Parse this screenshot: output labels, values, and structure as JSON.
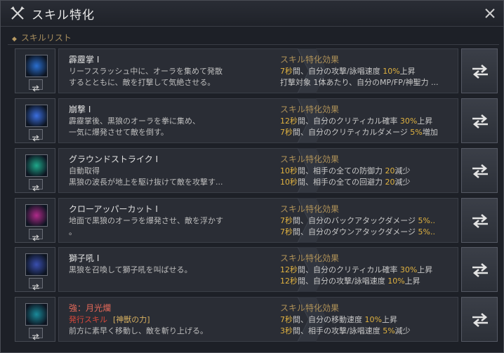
{
  "window": {
    "title": "スキル特化",
    "title_icon": "crossed-axes-icon",
    "close_icon": "close-icon"
  },
  "section": {
    "label": "スキルリスト"
  },
  "effects_header": "スキル特化効果",
  "skills": [
    {
      "name": "霹靂掌 I",
      "icon_color": "#2a6fd0",
      "desc": [
        "リーフスラッシュ中に、オーラを集めて発散",
        "するとともに、敵を打撃して気絶させる。"
      ],
      "effects": [
        [
          {
            "t": "7秒",
            "hl": true
          },
          {
            "t": "間、自分の攻撃/詠唱速度 "
          },
          {
            "t": "10%",
            "hl": true
          },
          {
            "t": "上昇"
          }
        ],
        [
          {
            "t": "打撃対象 1体あたり、自分のMP/FP/神聖力 ..."
          }
        ]
      ]
    },
    {
      "name": "崩撃 I",
      "icon_color": "#3b6fe0",
      "desc": [
        "霹靂掌後、黒狼のオーラを拳に集め、",
        "一気に爆発させて敵を倒す。"
      ],
      "effects": [
        [
          {
            "t": "12秒",
            "hl": true
          },
          {
            "t": "間、自分のクリティカル確率 "
          },
          {
            "t": "30%",
            "hl": true
          },
          {
            "t": "上昇"
          }
        ],
        [
          {
            "t": "7秒",
            "hl": true
          },
          {
            "t": "間、自分のクリティカルダメージ "
          },
          {
            "t": "5%",
            "hl": true
          },
          {
            "t": "増加"
          }
        ]
      ]
    },
    {
      "name": "グラウンドストライク I",
      "icon_color": "#1fa88a",
      "desc": [
        "自動取得",
        "黒狼の波長が地上を駆け抜けて敵を攻撃す..."
      ],
      "effects": [
        [
          {
            "t": "10秒",
            "hl": true
          },
          {
            "t": "間、相手の全ての防御力 "
          },
          {
            "t": "20",
            "hl": true
          },
          {
            "t": "減少"
          }
        ],
        [
          {
            "t": "10秒",
            "hl": true
          },
          {
            "t": "間、相手の全ての回避力 "
          },
          {
            "t": "20",
            "hl": true
          },
          {
            "t": "減少"
          }
        ]
      ]
    },
    {
      "name": "クローアッパーカット I",
      "icon_color": "#b02a8a",
      "desc": [
        "地面で黒狼のオーラを爆発させ、敵を浮かす",
        "。"
      ],
      "effects": [
        [
          {
            "t": "7秒",
            "hl": true
          },
          {
            "t": "間、自分のバックアタックダメージ "
          },
          {
            "t": "5%..",
            "hl": true
          }
        ],
        [
          {
            "t": "7秒",
            "hl": true
          },
          {
            "t": "間、自分のダウンアタックダメージ "
          },
          {
            "t": "5%..",
            "hl": true
          }
        ]
      ]
    },
    {
      "name": "獅子吼 I",
      "icon_color": "#3a4fb0",
      "desc": [
        "黒狼を召喚して獅子吼を叫ばせる。"
      ],
      "effects": [
        [
          {
            "t": "12秒",
            "hl": true
          },
          {
            "t": "間、自分のクリティカル確率 "
          },
          {
            "t": "30%",
            "hl": true
          },
          {
            "t": "上昇"
          }
        ],
        [
          {
            "t": "12秒",
            "hl": true
          },
          {
            "t": "間、自分の攻撃/詠唱速度 "
          },
          {
            "t": "10%",
            "hl": true
          },
          {
            "t": "上昇"
          }
        ]
      ]
    },
    {
      "name": "強：月光爛",
      "name_red": true,
      "icon_color": "#1a8a9a",
      "desc_tag": "発行スキル",
      "desc_tag2": "[神獣の力]",
      "desc": [
        "前方に素早く移動し、敵を斬り上げる。"
      ],
      "effects": [
        [
          {
            "t": "7秒",
            "hl": true
          },
          {
            "t": "間、自分の移動速度 "
          },
          {
            "t": "10%",
            "hl": true
          },
          {
            "t": "上昇"
          }
        ],
        [
          {
            "t": "3秒",
            "hl": true
          },
          {
            "t": "間、相手の攻撃/詠唱速度 "
          },
          {
            "t": "5%",
            "hl": true
          },
          {
            "t": "減少"
          }
        ]
      ]
    }
  ],
  "swap_icon": "swap-arrows-icon"
}
